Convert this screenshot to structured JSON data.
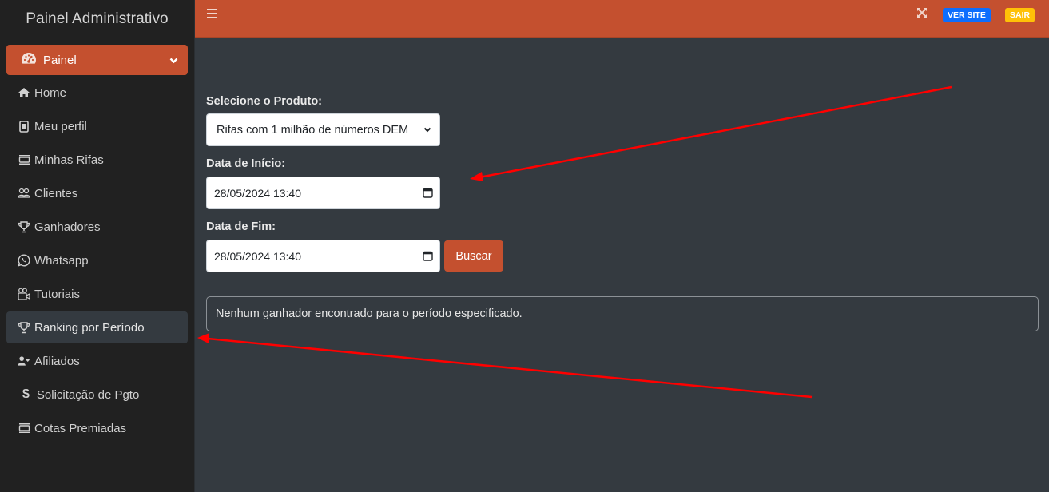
{
  "sidebar": {
    "brand": "Painel Administrativo",
    "parent": {
      "label": "Painel",
      "icon": "tachometer-icon",
      "expanded": true
    },
    "items": [
      {
        "label": "Home",
        "icon": "home-icon",
        "active": false
      },
      {
        "label": "Meu perfil",
        "icon": "id-badge-icon",
        "active": false
      },
      {
        "label": "Minhas Rifas",
        "icon": "ticket-list-icon",
        "active": false
      },
      {
        "label": "Clientes",
        "icon": "users-icon",
        "active": false
      },
      {
        "label": "Ganhadores",
        "icon": "trophy-icon",
        "active": false
      },
      {
        "label": "Whatsapp",
        "icon": "whatsapp-icon",
        "active": false
      },
      {
        "label": "Tutoriais",
        "icon": "video-camera-icon",
        "active": false
      },
      {
        "label": "Ranking por Período",
        "icon": "trophy-icon",
        "active": true
      },
      {
        "label": "Afiliados",
        "icon": "user-heart-icon",
        "active": false
      },
      {
        "label": "Solicitação de Pgto",
        "icon": "dollar-icon",
        "active": false
      },
      {
        "label": "Cotas Premiadas",
        "icon": "ticket-list-icon",
        "active": false
      }
    ]
  },
  "topbar": {
    "menu_icon": "hamburger-icon",
    "fullscreen_icon": "expand-icon",
    "ver_site_label": "VER SITE",
    "sair_label": "SAIR"
  },
  "form": {
    "product_label": "Selecione o Produto:",
    "product_selected": "Rifas com 1 milhão de números DEM",
    "start_label": "Data de Início:",
    "start_value": "28/05/2024 13:40",
    "end_label": "Data de Fim:",
    "end_value": "28/05/2024 13:40",
    "search_button": "Buscar"
  },
  "result": {
    "message": "Nenhum ganhador encontrado para o período especificado."
  },
  "colors": {
    "accent": "#c4502f",
    "sidebar_bg": "#212121",
    "content_bg": "#343a40",
    "ver_site": "#0d6efd",
    "sair": "#ffc107",
    "annotation_arrow": "#ff0000"
  }
}
